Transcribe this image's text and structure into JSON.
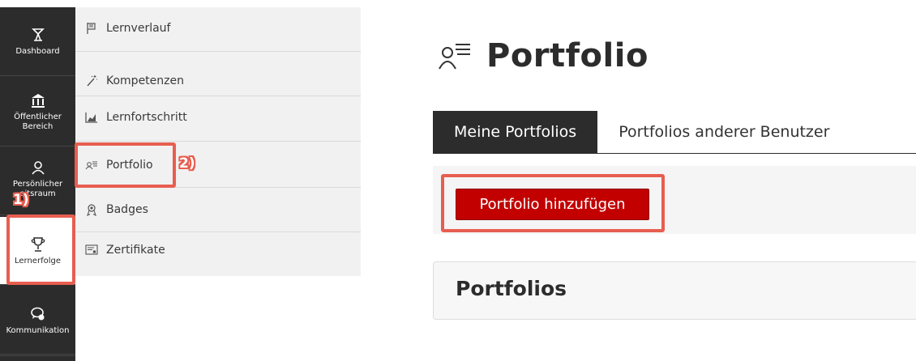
{
  "rail": {
    "items": [
      {
        "label": "Dashboard",
        "icon": "dashboard-icon"
      },
      {
        "label": "Öffentlicher Bereich",
        "icon": "bank-icon"
      },
      {
        "label": "Persönlicher Arbeitsraum",
        "label_visible": "Persönlicher\neitsraum",
        "icon": "person-icon"
      },
      {
        "label": "Lernerfolge",
        "icon": "trophy-icon"
      },
      {
        "label": "Kommunikation",
        "icon": "chat-icon"
      }
    ]
  },
  "submenu": {
    "items": [
      {
        "label": "Lernverlauf",
        "icon": "flag-icon"
      },
      {
        "label": "Kompetenzen",
        "icon": "wand-icon"
      },
      {
        "label": "Lernfortschritt",
        "icon": "chart-icon"
      },
      {
        "label": "Portfolio",
        "icon": "portfolio-icon"
      },
      {
        "label": "Badges",
        "icon": "badge-icon"
      },
      {
        "label": "Zertifikate",
        "icon": "certificate-icon"
      }
    ]
  },
  "annotations": {
    "step1": "1)",
    "step2": "2)"
  },
  "page": {
    "title": "Portfolio",
    "tabs": [
      {
        "label": "Meine Portfolios",
        "active": true
      },
      {
        "label": "Portfolios anderer Benutzer",
        "active": false
      }
    ],
    "add_button": "Portfolio hinzufügen",
    "panel_title": "Portfolios"
  },
  "colors": {
    "accent": "#c30000",
    "annotation": "#e75e50",
    "dark": "#2c2c2c"
  }
}
